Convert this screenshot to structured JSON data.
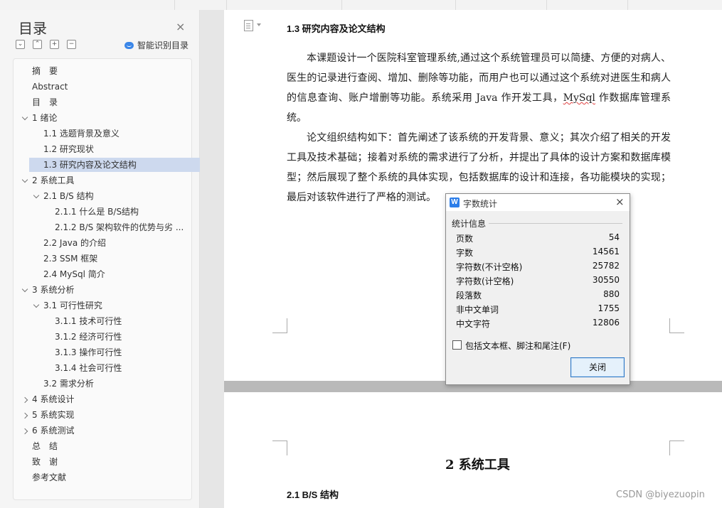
{
  "sidebar": {
    "title": "目录",
    "close_glyph": "×",
    "smart_toc_label": "智能识别目录",
    "toolbar": [
      "⌄",
      "⌃",
      "+",
      "−"
    ],
    "items": [
      {
        "label": "摘　要",
        "level": 0,
        "expander": "none"
      },
      {
        "label": "Abstract",
        "level": 0,
        "expander": "none"
      },
      {
        "label": "目　录",
        "level": 0,
        "expander": "none"
      },
      {
        "label": "1 绪论",
        "level": 0,
        "expander": "down"
      },
      {
        "label": "1.1 选题背景及意义",
        "level": 1,
        "expander": "none"
      },
      {
        "label": "1.2 研究现状",
        "level": 1,
        "expander": "none"
      },
      {
        "label": "1.3 研究内容及论文结构",
        "level": 1,
        "expander": "none",
        "active": true
      },
      {
        "label": "2 系统工具",
        "level": 0,
        "expander": "down"
      },
      {
        "label": "2.1 B/S 结构",
        "level": 1,
        "expander": "down"
      },
      {
        "label": "2.1.1  什么是 B/S结构",
        "level": 2,
        "expander": "none"
      },
      {
        "label": "2.1.2 B/S 架构软件的优势与劣 ...",
        "level": 2,
        "expander": "none"
      },
      {
        "label": "2.2 Java 的介绍",
        "level": 1,
        "expander": "none"
      },
      {
        "label": "2.3 SSM 框架",
        "level": 1,
        "expander": "none"
      },
      {
        "label": "2.4 MySql 简介",
        "level": 1,
        "expander": "none"
      },
      {
        "label": "3 系统分析",
        "level": 0,
        "expander": "down"
      },
      {
        "label": "3.1 可行性研究",
        "level": 1,
        "expander": "down"
      },
      {
        "label": "3.1.1  技术可行性",
        "level": 2,
        "expander": "none"
      },
      {
        "label": "3.1.2  经济可行性",
        "level": 2,
        "expander": "none"
      },
      {
        "label": "3.1.3  操作可行性",
        "level": 2,
        "expander": "none"
      },
      {
        "label": "3.1.4  社会可行性",
        "level": 2,
        "expander": "none"
      },
      {
        "label": "3.2  需求分析",
        "level": 1,
        "expander": "none"
      },
      {
        "label": "4 系统设计",
        "level": 0,
        "expander": "right"
      },
      {
        "label": "5 系统实现",
        "level": 0,
        "expander": "right"
      },
      {
        "label": "6 系统测试",
        "level": 0,
        "expander": "right"
      },
      {
        "label": "总　结",
        "level": 0,
        "expander": "none"
      },
      {
        "label": "致　谢",
        "level": 0,
        "expander": "none"
      },
      {
        "label": "参考文献",
        "level": 0,
        "expander": "none"
      }
    ]
  },
  "document": {
    "section_heading": "1.3 研究内容及论文结构",
    "para1_a": "本课题设计一个医院科室管理系统,通过这个系统管理员可以简捷、方便的对病人、医生的记录进行查阅、增加、删除等功能，而用户也可以通过这个系统对进医生和病人的信息查询、账户增删等功能。系统采用 Java 作开发工具，",
    "para1_flag": "MySql",
    "para1_b": " 作数据库管理系统。",
    "para2": "论文组织结构如下：首先阐述了该系统的开发背景、意义；其次介绍了相关的开发工具及技术基础；接着对系统的需求进行了分析，并提出了具体的设计方案和数据库模型；然后展现了整个系统的具体实现，包括数据库的设计和连接，各功能模块的实现；最后对该软件进行了严格的测试。",
    "chapter_heading": "2 系统工具",
    "sub_heading": "2.1 B/S 结构"
  },
  "dialog": {
    "title": "字数统计",
    "logo": "W",
    "close_glyph": "×",
    "group_label": "统计信息",
    "stats": [
      {
        "label": "页数",
        "value": "54"
      },
      {
        "label": "字数",
        "value": "14561"
      },
      {
        "label": "字符数(不计空格)",
        "value": "25782"
      },
      {
        "label": "字符数(计空格)",
        "value": "30550"
      },
      {
        "label": "段落数",
        "value": "880"
      },
      {
        "label": "非中文单词",
        "value": "1755"
      },
      {
        "label": "中文字符",
        "value": "12806"
      }
    ],
    "checkbox_label": "包括文本框、脚注和尾注(F)",
    "checkbox_checked": false,
    "close_button": "关闭"
  },
  "watermark": "CSDN @biyezuopin"
}
